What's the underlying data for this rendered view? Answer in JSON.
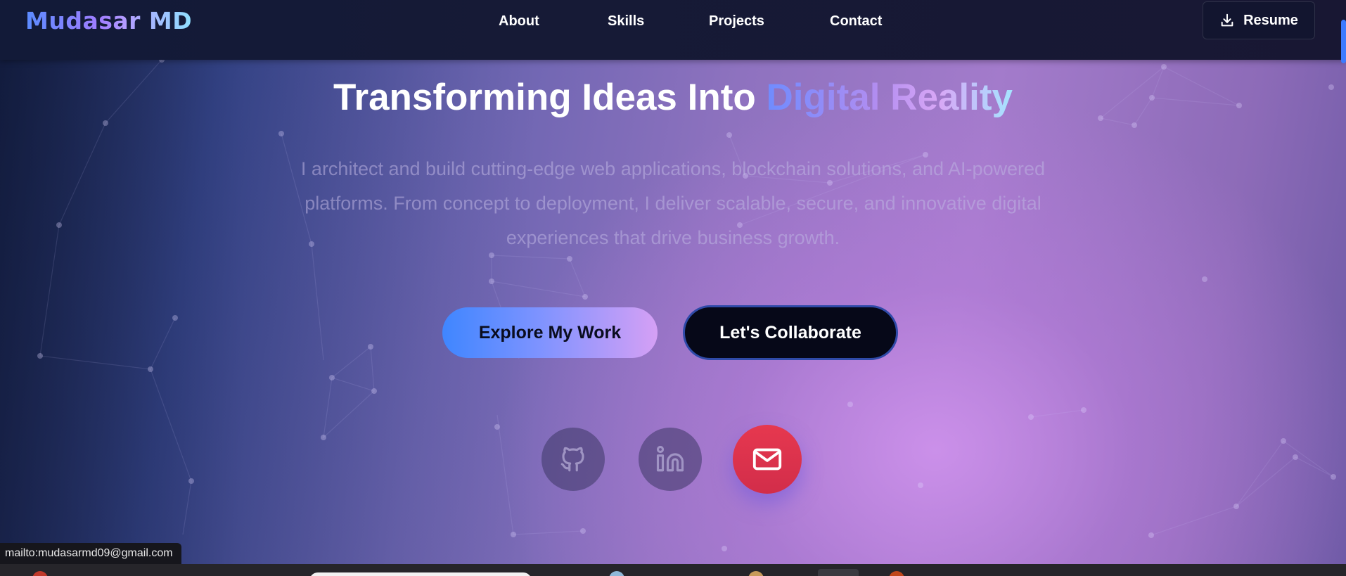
{
  "navbar": {
    "brand": "Mudasar MD",
    "links": [
      {
        "label": "About"
      },
      {
        "label": "Skills"
      },
      {
        "label": "Projects"
      },
      {
        "label": "Contact"
      }
    ],
    "resume_label": "Resume",
    "resume_icon": "download-icon"
  },
  "hero": {
    "headline_plain": "Transforming Ideas Into",
    "headline_accent": "Digital Reality",
    "subtext": "I architect and build cutting-edge web applications, blockchain solutions, and AI-powered platforms. From concept to deployment, I deliver scalable, secure, and innovative digital experiences that drive business growth.",
    "primary_cta": "Explore My Work",
    "secondary_cta": "Let's Collaborate"
  },
  "social": [
    {
      "name": "github",
      "icon": "github-icon"
    },
    {
      "name": "linkedin",
      "icon": "linkedin-icon"
    },
    {
      "name": "email",
      "icon": "mail-icon"
    }
  ],
  "status_bar": {
    "link_preview": "mailto:mudasarmd09@gmail.com"
  },
  "colors": {
    "accent_blue": "#3f86ff",
    "accent_purple": "#d5a0f5",
    "email_red": "#e6384f",
    "nav_bg": "#121a38"
  }
}
